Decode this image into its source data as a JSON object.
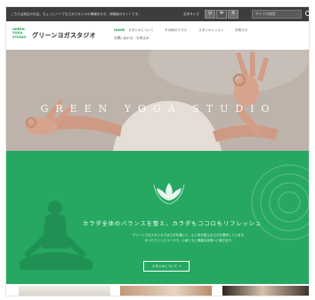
{
  "topbar": {
    "notice": "こちらは架空のお店、ちょっとハーブなヨガスタジオの情報を示す、体験版のサイトです。",
    "font_size_label": "文字サイズ",
    "font_sizes": [
      "小",
      "中",
      "大"
    ],
    "search_placeholder": "サイト内検索"
  },
  "header": {
    "logo_mark": [
      "GREEN",
      "YOGA",
      "STUDIO"
    ],
    "logo_text": "グリーンヨガスタジオ",
    "nav": [
      "HOME",
      "スタジオについて",
      "その他のクラス",
      "スタジオレッスン",
      "お知らせ",
      "お問い合わせ・お申込み"
    ]
  },
  "hero": {
    "title": "GREEN YOGA STUDIO"
  },
  "band": {
    "catch": "カラダ全体のバランスを整え、カラダもココロもリフレッシュ",
    "desc_lines": [
      "グリーンヨガスタジオではヨガを通じて、心と体を整えるヨガを提供しています。",
      "ゆったりとしたペースで、心身ともに健康な状態へと導きます。"
    ],
    "more_button": "スタジオについて →"
  },
  "colors": {
    "brand_green": "#27a862",
    "logo_green": "#1e9e56",
    "topbar": "#3d3d3d"
  }
}
